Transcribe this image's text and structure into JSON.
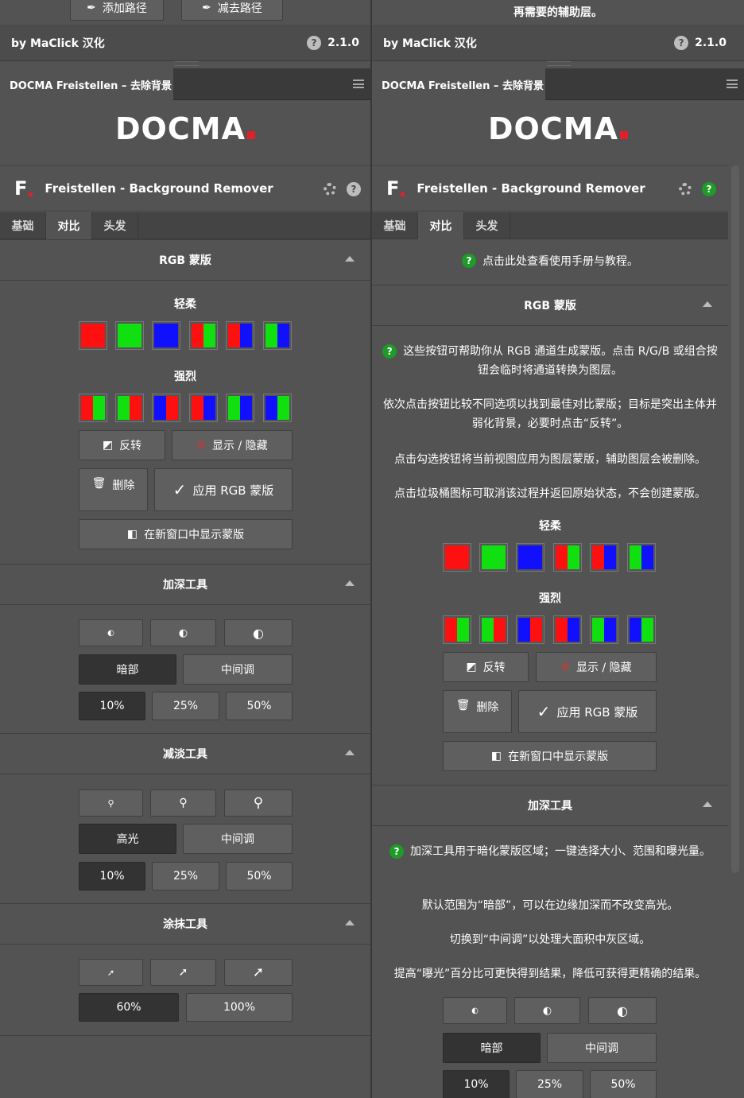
{
  "colors": {
    "red": "#ff1010",
    "green": "#10e010",
    "blue": "#1010ff",
    "bg": "#535353",
    "accent": "#e0202a"
  },
  "left": {
    "top_buttons": [
      "添加路径",
      "减去路径"
    ],
    "footer": {
      "credit": "by MaClick 汉化",
      "version": "2.1.0"
    },
    "panel_tab": "DOCMA Freistellen – 去除背景",
    "logo": "DOCMA",
    "header": {
      "letter": "F",
      "title": "Freistellen - Background Remover"
    },
    "subtabs": [
      "基础",
      "对比",
      "头发"
    ],
    "rgb": {
      "title": "RGB 蒙版",
      "soft": "轻柔",
      "strong": "强烈",
      "invert": "反转",
      "show_hide": "显示 / 隐藏",
      "delete": "删除",
      "apply": "应用 RGB 蒙版",
      "new_window": "在新窗口中显示蒙版"
    },
    "burn": {
      "title": "加深工具",
      "range": [
        "暗部",
        "中间调"
      ],
      "exposure": [
        "10%",
        "25%",
        "50%"
      ]
    },
    "dodge": {
      "title": "减淡工具",
      "range": [
        "高光",
        "中间调"
      ],
      "exposure": [
        "10%",
        "25%",
        "50%"
      ]
    },
    "smudge": {
      "title": "涂抹工具",
      "strength": [
        "60%",
        "100%"
      ]
    }
  },
  "right": {
    "top_text": "再需要的辅助层。",
    "footer": {
      "credit": "by MaClick 汉化",
      "version": "2.1.0"
    },
    "panel_tab": "DOCMA Freistellen – 去除背景",
    "logo": "DOCMA",
    "header": {
      "letter": "F",
      "title": "Freistellen - Background Remover"
    },
    "subtabs": [
      "基础",
      "对比",
      "头发"
    ],
    "help_link": "点击此处查看使用手册与教程。",
    "rgb": {
      "title": "RGB 蒙版",
      "help1": "这些按钮可帮助你从 RGB 通道生成蒙版。点击 R/G/B 或组合按钮会临时将通道转换为图层。",
      "help2": "依次点击按钮比较不同选项以找到最佳对比蒙版；目标是突出主体并弱化背景，必要时点击“反转”。",
      "help3": "点击勾选按钮将当前视图应用为图层蒙版，辅助图层会被删除。",
      "help4": "点击垃圾桶图标可取消该过程并返回原始状态，不会创建蒙版。",
      "soft": "轻柔",
      "strong": "强烈",
      "invert": "反转",
      "show_hide": "显示 / 隐藏",
      "delete": "删除",
      "apply": "应用 RGB 蒙版",
      "new_window": "在新窗口中显示蒙版"
    },
    "burn": {
      "title": "加深工具",
      "help1": "加深工具用于暗化蒙版区域；一键选择大小、范围和曝光量。",
      "help2": "默认范围为“暗部”，可以在边缘加深而不改变高光。",
      "help3": "切换到“中间调”以处理大面积中灰区域。",
      "help4": "提高“曝光”百分比可更快得到结果，降低可获得更精确的结果。",
      "range": [
        "暗部",
        "中间调"
      ],
      "exposure": [
        "10%",
        "25%",
        "50%"
      ]
    }
  }
}
